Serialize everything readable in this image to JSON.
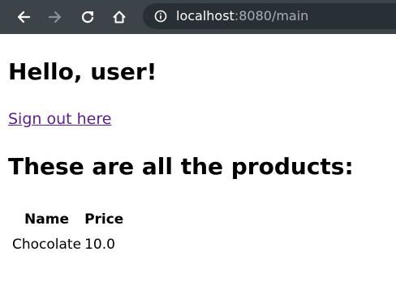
{
  "browser": {
    "url_host": "localhost",
    "url_rest": ":8080/main",
    "toolbar_bg": "#3c4449",
    "omnibox_bg": "#293035"
  },
  "page": {
    "greeting": "Hello, user!",
    "signout_link": "Sign out here",
    "products_heading": "These are all the products:",
    "table": {
      "headers": [
        "Name",
        "Price"
      ],
      "rows": [
        {
          "name": "Chocolate",
          "price": "10.0"
        }
      ]
    }
  },
  "colors": {
    "link_visited": "#5a1f8a"
  },
  "icons": {
    "back": "arrow-left",
    "forward": "arrow-right",
    "reload": "reload",
    "home": "home",
    "info": "info-circle"
  }
}
